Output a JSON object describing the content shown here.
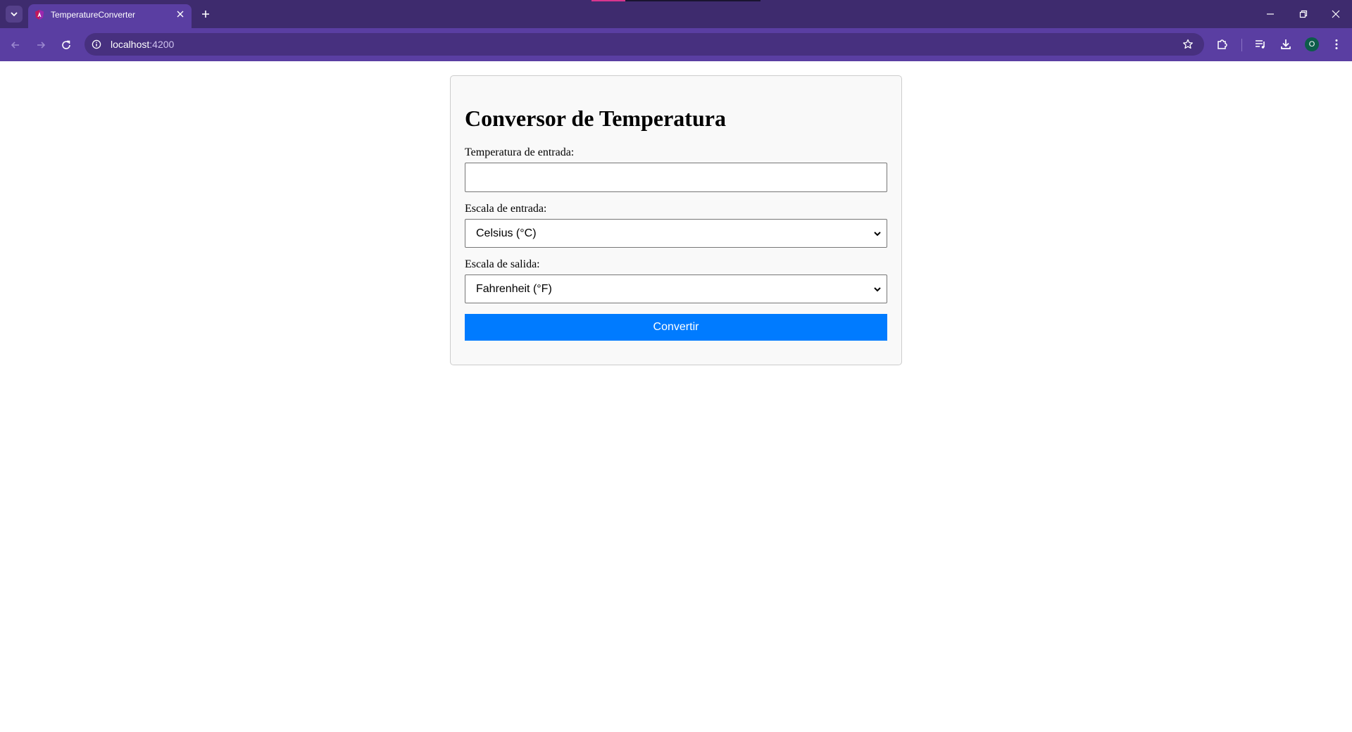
{
  "browser": {
    "tab": {
      "title": "TemperatureConverter",
      "icon": "angular-icon"
    },
    "url": {
      "host": "localhost",
      "port": ":4200"
    },
    "profile_initial": "O",
    "theme_color": "#5a3ea2"
  },
  "form": {
    "title": "Conversor de Temperatura",
    "input_label": "Temperatura de entrada:",
    "input_value": "",
    "input_scale_label": "Escala de entrada:",
    "input_scale_value": "Celsius (°C)",
    "output_scale_label": "Escala de salida:",
    "output_scale_value": "Fahrenheit (°F)",
    "button_label": "Convertir",
    "button_color": "#007bff"
  }
}
